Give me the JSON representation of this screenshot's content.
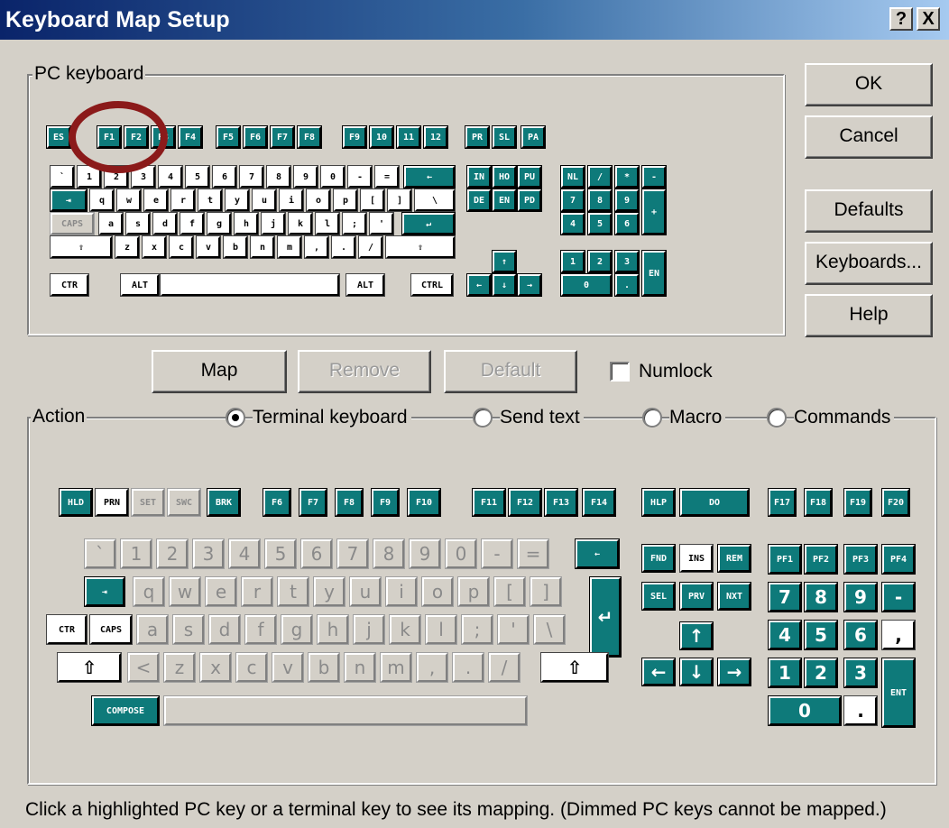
{
  "window": {
    "title": "Keyboard Map Setup",
    "help_label": "?",
    "close_label": "X"
  },
  "pc_group_label": "PC keyboard",
  "buttons": {
    "ok": "OK",
    "cancel": "Cancel",
    "defaults": "Defaults",
    "keyboards": "Keyboards...",
    "help": "Help"
  },
  "mid": {
    "map": "Map",
    "remove": "Remove",
    "default": "Default",
    "numlock": "Numlock",
    "numlock_checked": false
  },
  "action": {
    "label": "Action",
    "options": [
      "Terminal keyboard",
      "Send text",
      "Macro",
      "Commands"
    ],
    "selected": "Terminal keyboard"
  },
  "status_text": "Click a highlighted PC key or a terminal key to see its mapping. (Dimmed PC keys cannot be mapped.)",
  "annotation_color": "#8b1a1a",
  "pc_keys": {
    "row_fn": [
      "ES",
      "F1",
      "F2",
      "F3",
      "F4",
      "F5",
      "F6",
      "F7",
      "F8",
      "F9",
      "10",
      "11",
      "12",
      "PR",
      "SL",
      "PA"
    ],
    "row_num": [
      "`",
      "1",
      "2",
      "3",
      "4",
      "5",
      "6",
      "7",
      "8",
      "9",
      "0",
      "-",
      "=",
      "←"
    ],
    "row_q": [
      "⇥",
      "q",
      "w",
      "e",
      "r",
      "t",
      "y",
      "u",
      "i",
      "o",
      "p",
      "[",
      "]",
      "\\"
    ],
    "row_a": [
      "CAPS",
      "a",
      "s",
      "d",
      "f",
      "g",
      "h",
      "j",
      "k",
      "l",
      ";",
      "'",
      "↵"
    ],
    "row_z": [
      "⇧",
      "z",
      "x",
      "c",
      "v",
      "b",
      "n",
      "m",
      ",",
      ".",
      "/",
      "⇧"
    ],
    "row_ctl": [
      "CTR",
      "ALT",
      "",
      "ALT",
      "CTRL"
    ],
    "nav": [
      "IN",
      "HO",
      "PU",
      "DE",
      "EN",
      "PD",
      "↑",
      "←",
      "↓",
      "→"
    ],
    "numpad": [
      "NL",
      "/",
      "*",
      "-",
      "7",
      "8",
      "9",
      "+",
      "4",
      "5",
      "6",
      "1",
      "2",
      "3",
      "EN",
      "0",
      "."
    ]
  },
  "term_keys": {
    "fn": [
      "HLD",
      "PRN",
      "SET",
      "SWC",
      "BRK",
      "F6",
      "F7",
      "F8",
      "F9",
      "F10",
      "F11",
      "F12",
      "F13",
      "F14",
      "HLP",
      "DO",
      "F17",
      "F18",
      "F19",
      "F20"
    ],
    "row_num": [
      "`",
      "1",
      "2",
      "3",
      "4",
      "5",
      "6",
      "7",
      "8",
      "9",
      "0",
      "-",
      "=",
      "←"
    ],
    "row_q": [
      "⇥",
      "q",
      "w",
      "e",
      "r",
      "t",
      "y",
      "u",
      "i",
      "o",
      "p",
      "[",
      "]",
      "↵"
    ],
    "row_a": [
      "CTR",
      "CAPS",
      "a",
      "s",
      "d",
      "f",
      "g",
      "h",
      "j",
      "k",
      "l",
      ";",
      "'",
      "\\"
    ],
    "row_z": [
      "⇧",
      "<",
      "z",
      "x",
      "c",
      "v",
      "b",
      "n",
      "m",
      ",",
      ".",
      "/",
      "⇧"
    ],
    "compose": "COMPOSE",
    "edit": [
      "FND",
      "INS",
      "REM",
      "SEL",
      "PRV",
      "NXT",
      "↑",
      "←",
      "↓",
      "→"
    ],
    "numpad": [
      "PF1",
      "PF2",
      "PF3",
      "PF4",
      "7",
      "8",
      "9",
      "-",
      "4",
      "5",
      "6",
      ",",
      "1",
      "2",
      "3",
      "ENT",
      "0",
      "."
    ]
  }
}
